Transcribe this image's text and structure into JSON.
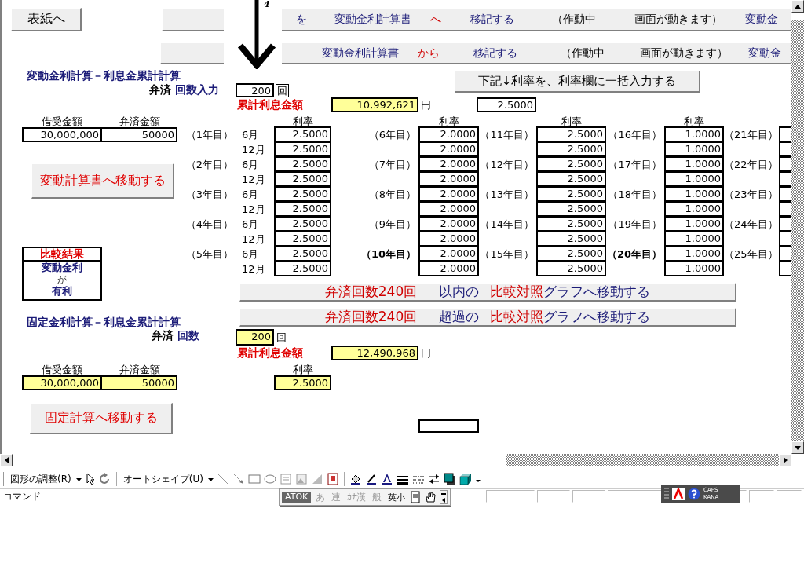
{
  "nav_button": "表紙へ",
  "arrow_label": "4",
  "transfer_buttons": [
    {
      "segments": [
        {
          "text": "を",
          "kind": "label"
        },
        {
          "text": "変動金利計算書",
          "kind": "label"
        },
        {
          "text": "へ",
          "kind": "highlight"
        },
        {
          "text": "移記する",
          "kind": "label"
        },
        {
          "text": "（作動中",
          "kind": "note"
        },
        {
          "text": "画面が動きます）",
          "kind": "note"
        },
        {
          "text": "変動金",
          "kind": "label"
        }
      ]
    },
    {
      "segments": [
        {
          "text": "変動金利計算書",
          "kind": "label"
        },
        {
          "text": "から",
          "kind": "highlight"
        },
        {
          "text": "移記する",
          "kind": "label"
        },
        {
          "text": "（作動中",
          "kind": "note"
        },
        {
          "text": "画面が動きます）",
          "kind": "note"
        },
        {
          "text": "変動金",
          "kind": "label"
        }
      ]
    }
  ],
  "bulk_rate_button": "下記↓利率を、利率欄に一括入力する",
  "variable": {
    "title": "変動金利計算－利息金累計計算",
    "repay_label": "弁済",
    "count_label": "回数入力",
    "count": "200",
    "count_unit": "回",
    "total_label": "累計利息金額",
    "total": "10,992,621",
    "total_unit": "円",
    "rate_input": "2.5000",
    "loan_header": "借受金額",
    "repay_header": "弁済金額",
    "loan": "30,000,000",
    "repayment": "50000",
    "move_button": "変動計算書へ移動する"
  },
  "rate_groups": [
    {
      "header": "利率",
      "years": [
        {
          "label": "（1年目）",
          "bold": false,
          "periods": [
            {
              "month": "6月",
              "rate": "2.5000"
            },
            {
              "month": "12月",
              "rate": "2.5000"
            }
          ]
        },
        {
          "label": "（2年目）",
          "bold": false,
          "periods": [
            {
              "month": "6月",
              "rate": "2.5000"
            },
            {
              "month": "12月",
              "rate": "2.5000"
            }
          ]
        },
        {
          "label": "（3年目）",
          "bold": false,
          "periods": [
            {
              "month": "6月",
              "rate": "2.5000"
            },
            {
              "month": "12月",
              "rate": "2.5000"
            }
          ]
        },
        {
          "label": "（4年目）",
          "bold": false,
          "periods": [
            {
              "month": "6月",
              "rate": "2.5000"
            },
            {
              "month": "12月",
              "rate": "2.5000"
            }
          ]
        },
        {
          "label": "（5年目）",
          "bold": false,
          "periods": [
            {
              "month": "6月",
              "rate": "2.5000"
            },
            {
              "month": "12月",
              "rate": "2.5000"
            }
          ]
        }
      ]
    },
    {
      "header": "利率",
      "years": [
        {
          "label": "（6年目）",
          "bold": false,
          "periods": [
            {
              "rate": "2.0000"
            },
            {
              "rate": "2.0000"
            }
          ]
        },
        {
          "label": "（7年目）",
          "bold": false,
          "periods": [
            {
              "rate": "2.0000"
            },
            {
              "rate": "2.0000"
            }
          ]
        },
        {
          "label": "（8年目）",
          "bold": false,
          "periods": [
            {
              "rate": "2.0000"
            },
            {
              "rate": "2.0000"
            }
          ]
        },
        {
          "label": "（9年目）",
          "bold": false,
          "periods": [
            {
              "rate": "2.0000"
            },
            {
              "rate": "2.0000"
            }
          ]
        },
        {
          "label": "（10年目）",
          "bold": true,
          "periods": [
            {
              "rate": "2.0000"
            },
            {
              "rate": "2.0000"
            }
          ]
        }
      ]
    },
    {
      "header": "利率",
      "years": [
        {
          "label": "（11年目）",
          "bold": false,
          "periods": [
            {
              "rate": "2.5000"
            },
            {
              "rate": "2.5000"
            }
          ]
        },
        {
          "label": "（12年目）",
          "bold": false,
          "periods": [
            {
              "rate": "2.5000"
            },
            {
              "rate": "2.5000"
            }
          ]
        },
        {
          "label": "（13年目）",
          "bold": false,
          "periods": [
            {
              "rate": "2.5000"
            },
            {
              "rate": "2.5000"
            }
          ]
        },
        {
          "label": "（14年目）",
          "bold": false,
          "periods": [
            {
              "rate": "2.5000"
            },
            {
              "rate": "2.5000"
            }
          ]
        },
        {
          "label": "（15年目）",
          "bold": false,
          "periods": [
            {
              "rate": "2.5000"
            },
            {
              "rate": "2.5000"
            }
          ]
        }
      ]
    },
    {
      "header": "利率",
      "years": [
        {
          "label": "（16年目）",
          "bold": false,
          "periods": [
            {
              "rate": "1.0000"
            },
            {
              "rate": "1.0000"
            }
          ]
        },
        {
          "label": "（17年目）",
          "bold": false,
          "periods": [
            {
              "rate": "1.0000"
            },
            {
              "rate": "1.0000"
            }
          ]
        },
        {
          "label": "（18年目）",
          "bold": false,
          "periods": [
            {
              "rate": "1.0000"
            },
            {
              "rate": "1.0000"
            }
          ]
        },
        {
          "label": "（19年目）",
          "bold": false,
          "periods": [
            {
              "rate": "1.0000"
            },
            {
              "rate": "1.0000"
            }
          ]
        },
        {
          "label": "（20年目）",
          "bold": true,
          "periods": [
            {
              "rate": "1.0000"
            },
            {
              "rate": "1.0000"
            }
          ]
        }
      ]
    },
    {
      "years": [
        {
          "label": "（21年目）",
          "bold": false
        },
        {
          "label": "（22年目）",
          "bold": false
        },
        {
          "label": "（23年目）",
          "bold": false
        },
        {
          "label": "（24年目）",
          "bold": false
        },
        {
          "label": "（25年目）",
          "bold": false
        }
      ]
    }
  ],
  "comparison": {
    "title": "比較結果",
    "lines": [
      {
        "text": "変動金利",
        "kind": "emphasis"
      },
      {
        "text": "が",
        "kind": "plain"
      },
      {
        "text": "有利",
        "kind": "emphasis"
      }
    ]
  },
  "graph_buttons": [
    {
      "segments": [
        {
          "text": "弁済回数240回",
          "kind": "highlight"
        },
        {
          "text": "以内の",
          "kind": "label"
        },
        {
          "text": "比較対照",
          "kind": "highlight"
        },
        {
          "text": "グラフへ移動する",
          "kind": "label"
        }
      ]
    },
    {
      "segments": [
        {
          "text": "弁済回数240回",
          "kind": "highlight"
        },
        {
          "text": "超過の",
          "kind": "label"
        },
        {
          "text": "比較対照",
          "kind": "highlight"
        },
        {
          "text": "グラフへ移動する",
          "kind": "label"
        }
      ]
    }
  ],
  "fixed": {
    "title": "固定金利計算－利息金累計計算",
    "repay_label": "弁済",
    "count_label": "回数",
    "count": "200",
    "count_unit": "回",
    "total_label": "累計利息金額",
    "total": "12,490,968",
    "total_unit": "円",
    "loan_header": "借受金額",
    "repay_header": "弁済金額",
    "rate_header": "利率",
    "loan": "30,000,000",
    "repayment": "50000",
    "rate": "2.5000",
    "move_button": "固定計算へ移動する"
  },
  "toolbar": {
    "draw_menu": "図形の調整(R)",
    "autoshape_menu": "オートシェイプ(U)"
  },
  "ime_bar": {
    "logo": "ATOK",
    "items": [
      {
        "text": "あ",
        "disabled": true
      },
      {
        "text": "連",
        "disabled": true
      },
      {
        "text": "ｶﾅ漢",
        "disabled": true
      },
      {
        "text": "般",
        "disabled": true
      },
      {
        "text": "英小",
        "disabled": false
      }
    ]
  },
  "language_bar": {
    "caps": "CAPS",
    "kana": "KANA"
  },
  "status_bar": {
    "mode": "コマンド"
  }
}
